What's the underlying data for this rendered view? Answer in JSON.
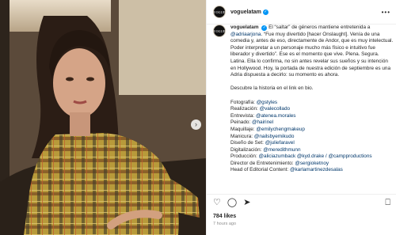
{
  "post": {
    "username": "voguelatam",
    "avatar_text": "VOGUE",
    "likes": "784 likes",
    "time_ago": "7 hours ago"
  },
  "caption": {
    "intro": "El “saltar” de géneros mantiene entretenida a",
    "intro_mention": "@adriaarjona",
    "intro_rest": ". “Fue muy divertido [hacer Onslaught]. Venía de una comedia y, antes de eso, directamente de Andor, que es muy intelectual. Poder interpretar a un personaje mucho más físico e intuitivo fue liberador y divertido”. Ese es el momento que vive. Plena. Segura. Latina. Ella lo confirma, no sin antes revelar sus sueños y su intención en Hollywood. Hoy, la portada de nuestra edición de septiembre es una Adria dispuesta a decirlo: su momento es ahora.",
    "cta": "Descubre la historia en el link en bio.",
    "credits": [
      {
        "label": "Fotografía: ",
        "handle": "@gstyles"
      },
      {
        "label": "Realización: ",
        "handle": "@valecollado"
      },
      {
        "label": "Entrevista: ",
        "handle": "@atenea.morales"
      },
      {
        "label": "Peinado: ",
        "handle": "@hairinel"
      },
      {
        "label": "Maquillaje: ",
        "handle": "@emilychengmakeup"
      },
      {
        "label": "Manicura: ",
        "handle": "@nailsbyemikudo"
      },
      {
        "label": "Diseño de Set: ",
        "handle": "@juliefaravel"
      },
      {
        "label": "Digitalización: ",
        "handle": "@meredithmunn"
      },
      {
        "label": "Producción: ",
        "handle": "@aliciazumback @kyd.drake / @campproductions"
      },
      {
        "label": "Director de Entretenimiento: ",
        "handle": "@sergioketnoy"
      },
      {
        "label": "Head of Editorial Content: ",
        "handle": "@karlamartinezdesalas"
      }
    ]
  },
  "icons": {
    "verified": "✓",
    "more": "•••",
    "next": "›",
    "like": "♡",
    "comment": "◯",
    "share": "➤",
    "save": "⎕"
  },
  "colors": {
    "link": "#00376b",
    "verified": "#0095f6"
  }
}
